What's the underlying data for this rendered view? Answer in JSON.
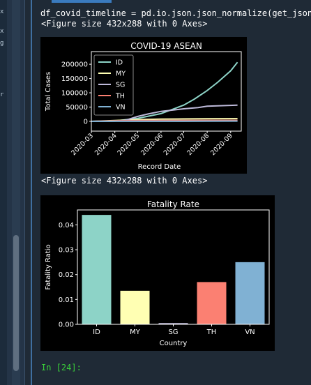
{
  "gutter": {
    "chars": [
      "x",
      "x",
      "g",
      "r"
    ]
  },
  "code": {
    "line": "df_covid_timeline = pd.io.json.json_normalize(get_json"
  },
  "outputs": {
    "fig1_label": "<Figure size 432x288 with 0 Axes>",
    "fig2_label": "<Figure size 432x288 with 0 Axes>"
  },
  "prompt": {
    "text": "In [24]:"
  },
  "chart_data": [
    {
      "type": "line",
      "title": "COVID-19 ASEAN",
      "xlabel": "Record Date",
      "ylabel": "Total Cases",
      "x_ticks": [
        "2020-03",
        "2020-04",
        "2020-05",
        "2020-06",
        "2020-07",
        "2020-08",
        "2020-09"
      ],
      "y_ticks": [
        "0",
        "50000",
        "100000",
        "150000",
        "200000"
      ],
      "ylim": [
        0,
        210000
      ],
      "x_start": "2020-03-01",
      "x_end": "2020-09-15",
      "legend": "top-left",
      "grid": false,
      "series": [
        {
          "name": "ID",
          "color": "#8dd3c7",
          "points": [
            [
              "2020-03-01",
              0
            ],
            [
              "2020-04-01",
              1500
            ],
            [
              "2020-05-01",
              10500
            ],
            [
              "2020-06-01",
              27000
            ],
            [
              "2020-07-01",
              57000
            ],
            [
              "2020-07-15",
              78000
            ],
            [
              "2020-08-01",
              108000
            ],
            [
              "2020-08-15",
              137000
            ],
            [
              "2020-09-01",
              177000
            ],
            [
              "2020-09-10",
              207000
            ]
          ]
        },
        {
          "name": "MY",
          "color": "#ffffb3",
          "points": [
            [
              "2020-03-01",
              30
            ],
            [
              "2020-04-01",
              2900
            ],
            [
              "2020-05-01",
              6100
            ],
            [
              "2020-06-01",
              7800
            ],
            [
              "2020-07-01",
              8600
            ],
            [
              "2020-08-01",
              9000
            ],
            [
              "2020-09-10",
              9500
            ]
          ]
        },
        {
          "name": "SG",
          "color": "#bebada",
          "points": [
            [
              "2020-03-01",
              100
            ],
            [
              "2020-04-01",
              1000
            ],
            [
              "2020-04-15",
              3700
            ],
            [
              "2020-05-01",
              17000
            ],
            [
              "2020-05-15",
              26000
            ],
            [
              "2020-06-01",
              35000
            ],
            [
              "2020-07-01",
              44000
            ],
            [
              "2020-07-20",
              48000
            ],
            [
              "2020-08-01",
              53000
            ],
            [
              "2020-09-10",
              57000
            ]
          ]
        },
        {
          "name": "TH",
          "color": "#fb8072",
          "points": [
            [
              "2020-03-01",
              40
            ],
            [
              "2020-04-01",
              1700
            ],
            [
              "2020-05-01",
              2950
            ],
            [
              "2020-06-01",
              3080
            ],
            [
              "2020-07-01",
              3170
            ],
            [
              "2020-08-01",
              3310
            ],
            [
              "2020-09-10",
              3450
            ]
          ]
        },
        {
          "name": "VN",
          "color": "#80b1d3",
          "points": [
            [
              "2020-03-01",
              16
            ],
            [
              "2020-04-01",
              220
            ],
            [
              "2020-05-01",
              270
            ],
            [
              "2020-06-01",
              330
            ],
            [
              "2020-07-01",
              360
            ],
            [
              "2020-08-01",
              700
            ],
            [
              "2020-09-10",
              1060
            ]
          ]
        }
      ]
    },
    {
      "type": "bar",
      "title": "Fatality Rate",
      "xlabel": "Country",
      "ylabel": "Fatality Ratio",
      "categories": [
        "ID",
        "MY",
        "SG",
        "TH",
        "VN"
      ],
      "values": [
        0.044,
        0.0135,
        0.0005,
        0.017,
        0.025
      ],
      "colors": [
        "#8dd3c7",
        "#ffffb3",
        "#bebada",
        "#fb8072",
        "#80b1d3"
      ],
      "y_ticks": [
        "0.00",
        "0.01",
        "0.02",
        "0.03",
        "0.04"
      ],
      "ylim": [
        0,
        0.046
      ],
      "grid": false
    }
  ]
}
